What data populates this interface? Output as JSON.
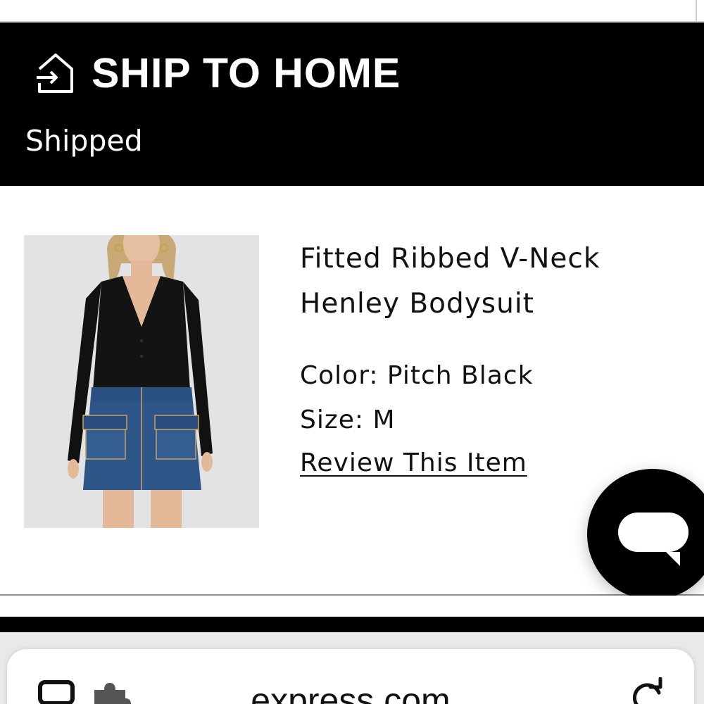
{
  "shipment": {
    "title": "SHIP TO HOME",
    "status": "Shipped",
    "icon": "home-arrow-icon"
  },
  "item": {
    "name_line1": "Fitted Ribbed V-Neck",
    "name_line2": "Henley Bodysuit",
    "color_label": "Color: Pitch Black",
    "size_label": "Size: M",
    "review_link": "Review This Item",
    "image_alt": "Model wearing black ribbed v-neck henley bodysuit with denim mini skirt"
  },
  "chat": {
    "icon": "chat-bubble-icon"
  },
  "browser": {
    "url": "express.com",
    "icons": [
      "tabs-icon",
      "extension-icon",
      "reload-icon"
    ]
  },
  "colors": {
    "header_bg": "#000000",
    "header_text": "#ffffff",
    "text": "#111111",
    "browser_bg": "#e9e9ec"
  }
}
